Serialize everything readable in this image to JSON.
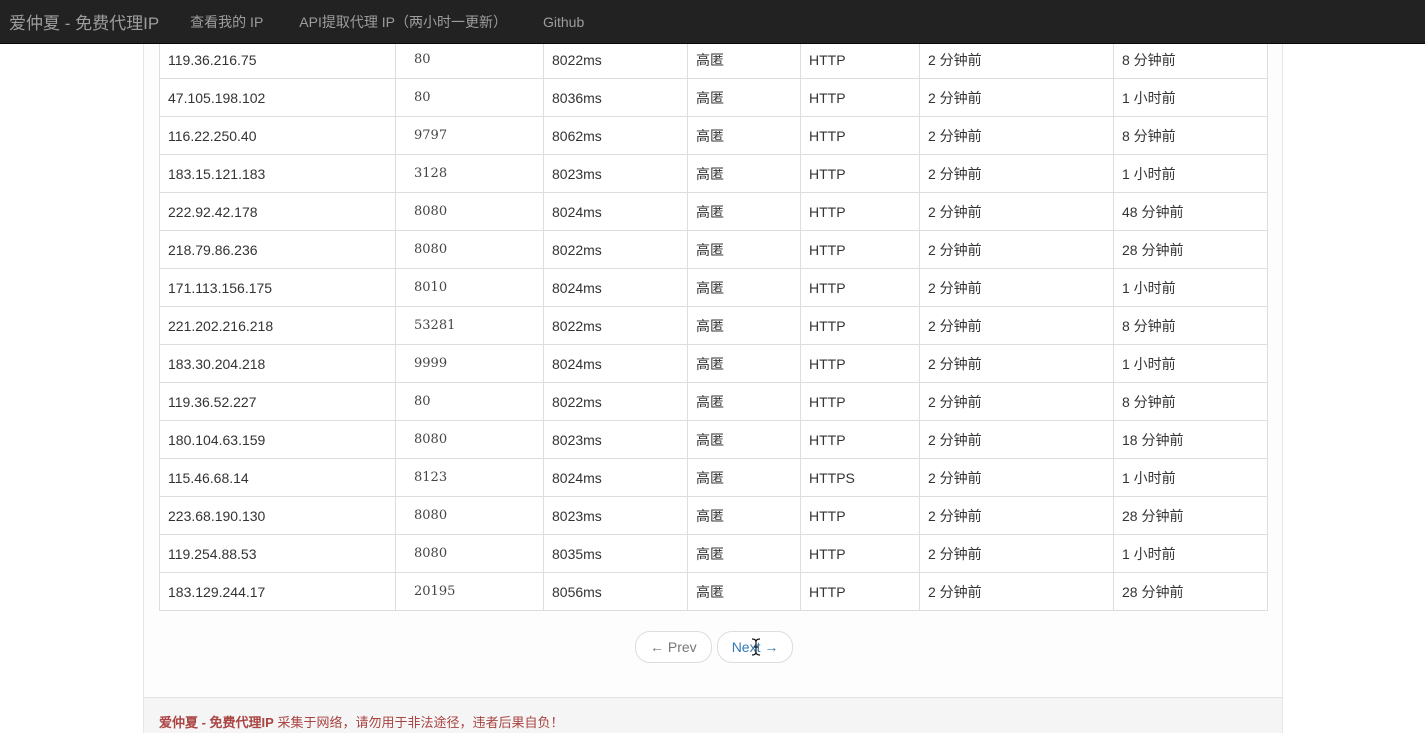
{
  "navbar": {
    "brand": "爱仲夏 - 免费代理IP",
    "links": [
      "查看我的 IP",
      "API提取代理 IP（两小时一更新）",
      "Github"
    ]
  },
  "table": {
    "rows": [
      [
        "119.36.216.75",
        "80",
        "8022ms",
        "高匿",
        "HTTP",
        "2 分钟前",
        "8 分钟前"
      ],
      [
        "47.105.198.102",
        "80",
        "8036ms",
        "高匿",
        "HTTP",
        "2 分钟前",
        "1 小时前"
      ],
      [
        "116.22.250.40",
        "9797",
        "8062ms",
        "高匿",
        "HTTP",
        "2 分钟前",
        "8 分钟前"
      ],
      [
        "183.15.121.183",
        "3128",
        "8023ms",
        "高匿",
        "HTTP",
        "2 分钟前",
        "1 小时前"
      ],
      [
        "222.92.42.178",
        "8080",
        "8024ms",
        "高匿",
        "HTTP",
        "2 分钟前",
        "48 分钟前"
      ],
      [
        "218.79.86.236",
        "8080",
        "8022ms",
        "高匿",
        "HTTP",
        "2 分钟前",
        "28 分钟前"
      ],
      [
        "171.113.156.175",
        "8010",
        "8024ms",
        "高匿",
        "HTTP",
        "2 分钟前",
        "1 小时前"
      ],
      [
        "221.202.216.218",
        "53281",
        "8022ms",
        "高匿",
        "HTTP",
        "2 分钟前",
        "8 分钟前"
      ],
      [
        "183.30.204.218",
        "9999",
        "8024ms",
        "高匿",
        "HTTP",
        "2 分钟前",
        "1 小时前"
      ],
      [
        "119.36.52.227",
        "80",
        "8022ms",
        "高匿",
        "HTTP",
        "2 分钟前",
        "8 分钟前"
      ],
      [
        "180.104.63.159",
        "8080",
        "8023ms",
        "高匿",
        "HTTP",
        "2 分钟前",
        "18 分钟前"
      ],
      [
        "115.46.68.14",
        "8123",
        "8024ms",
        "高匿",
        "HTTPS",
        "2 分钟前",
        "1 小时前"
      ],
      [
        "223.68.190.130",
        "8080",
        "8023ms",
        "高匿",
        "HTTP",
        "2 分钟前",
        "28 分钟前"
      ],
      [
        "119.254.88.53",
        "8080",
        "8035ms",
        "高匿",
        "HTTP",
        "2 分钟前",
        "1 小时前"
      ],
      [
        "183.129.244.17",
        "20195",
        "8056ms",
        "高匿",
        "HTTP",
        "2 分钟前",
        "28 分钟前"
      ]
    ]
  },
  "pager": {
    "prev_label": "← Prev",
    "next_label": "Next →"
  },
  "footer": {
    "brand": "爱仲夏 - 免费代理IP",
    "text": " 采集于网络，请勿用于非法途径，违者后果自负！"
  },
  "colors": {
    "navbar_bg": "#222222",
    "link": "#337ab7",
    "footer_text": "#a94442"
  }
}
